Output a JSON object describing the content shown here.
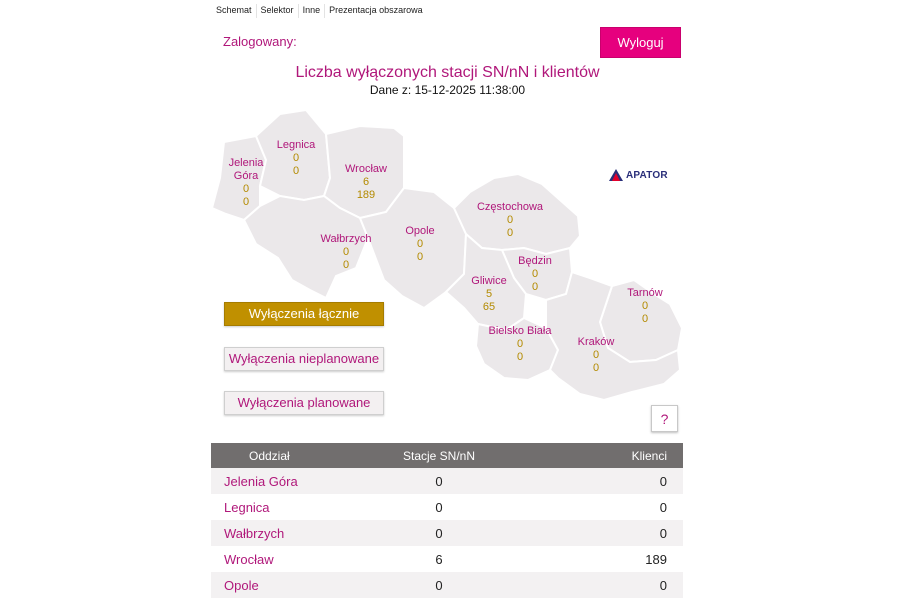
{
  "menu": [
    "Schemat",
    "Selektor",
    "Inne",
    "Prezentacja obszarowa"
  ],
  "header": {
    "logged_label": "Zalogowany:",
    "logout_label": "Wyloguj",
    "title": "Liczba wyłączonych stacji SN/nN i klientów",
    "subtitle": "Dane z: 15-12-2025 11:38:00"
  },
  "logo": {
    "text": "APATOR"
  },
  "regions": [
    {
      "name": "Jelenia\nGóra",
      "stations": "0",
      "clients": "0"
    },
    {
      "name": "Legnica",
      "stations": "0",
      "clients": "0"
    },
    {
      "name": "Wrocław",
      "stations": "6",
      "clients": "189"
    },
    {
      "name": "Wałbrzych",
      "stations": "0",
      "clients": "0"
    },
    {
      "name": "Opole",
      "stations": "0",
      "clients": "0"
    },
    {
      "name": "Częstochowa",
      "stations": "0",
      "clients": "0"
    },
    {
      "name": "Będzin",
      "stations": "0",
      "clients": "0"
    },
    {
      "name": "Gliwice",
      "stations": "5",
      "clients": "65"
    },
    {
      "name": "Tarnów",
      "stations": "0",
      "clients": "0"
    },
    {
      "name": "Bielsko Biała",
      "stations": "0",
      "clients": "0"
    },
    {
      "name": "Kraków",
      "stations": "0",
      "clients": "0"
    }
  ],
  "buttons": {
    "total": "Wyłączenia łącznie",
    "unplanned": "Wyłączenia nieplanowane",
    "planned": "Wyłączenia planowane",
    "help": "?"
  },
  "table": {
    "headers": [
      "Oddział",
      "Stacje SN/nN",
      "Klienci"
    ],
    "rows": [
      [
        "Jelenia Góra",
        "0",
        "0"
      ],
      [
        "Legnica",
        "0",
        "0"
      ],
      [
        "Wałbrzych",
        "0",
        "0"
      ],
      [
        "Wrocław",
        "6",
        "189"
      ],
      [
        "Opole",
        "0",
        "0"
      ]
    ]
  },
  "colors": {
    "accent": "#e6007e",
    "title": "#b0177a",
    "value": "#b38a00",
    "active_button": "#c09000",
    "table_header": "#716e6e",
    "map_fill": "#ebe8ea"
  }
}
